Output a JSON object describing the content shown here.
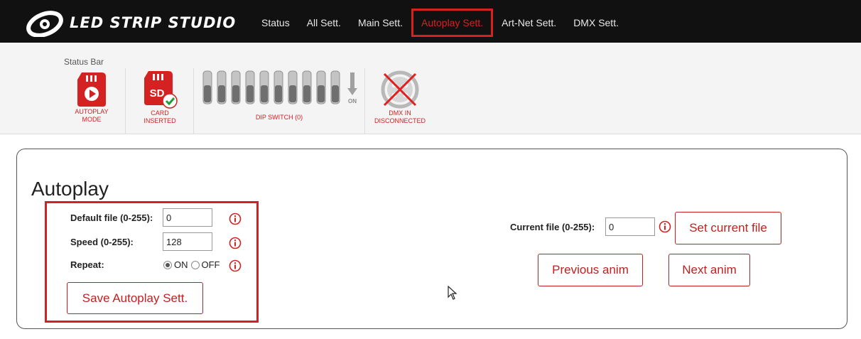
{
  "brand": {
    "name": "LED STRIP STUDIO"
  },
  "nav": {
    "items": [
      {
        "label": "Status"
      },
      {
        "label": "All Sett."
      },
      {
        "label": "Main Sett."
      },
      {
        "label": "Autoplay Sett.",
        "active": true
      },
      {
        "label": "Art-Net Sett."
      },
      {
        "label": "DMX Sett."
      }
    ]
  },
  "status_bar": {
    "label": "Status Bar",
    "autoplay": {
      "caption_line1": "AUTOPLAY",
      "caption_line2": "MODE",
      "icon": "sd-play-icon"
    },
    "card": {
      "caption_line1": "CARD",
      "caption_line2": "INSERTED",
      "icon_text": "SD",
      "icon": "sd-card-check-icon"
    },
    "dip": {
      "caption": "DIP SWITCH (0)",
      "on_label": "ON",
      "switch_count": 10,
      "value": 0
    },
    "dmx": {
      "caption_line1": "DMX IN",
      "caption_line2": "DISCONNECTED",
      "icon": "dmx-disconnected-icon"
    }
  },
  "autoplay": {
    "title": "Autoplay",
    "default_file": {
      "label": "Default file (0-255):",
      "value": "0"
    },
    "speed": {
      "label": "Speed (0-255):",
      "value": "128"
    },
    "repeat": {
      "label": "Repeat:",
      "on_label": "ON",
      "off_label": "OFF",
      "selected": "ON"
    },
    "save_label": "Save Autoplay Sett.",
    "current_file": {
      "label": "Current file (0-255):",
      "value": "0"
    },
    "set_current_label": "Set current file",
    "previous_label": "Previous anim",
    "next_label": "Next anim"
  },
  "colors": {
    "accent": "#d42222",
    "nav_bg": "#111111",
    "status_bg": "#f4f4f4"
  }
}
